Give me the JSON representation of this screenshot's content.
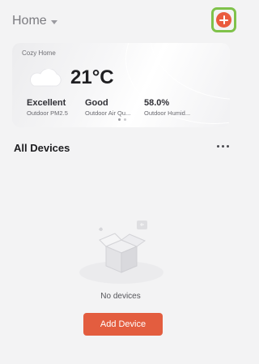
{
  "header": {
    "home_name": "Home",
    "add_button_color": "#ea5b3e",
    "highlight_color": "#7fc24a"
  },
  "weather_card": {
    "home_label": "Cozy Home",
    "weather_icon": "cloud-icon",
    "temperature": "21°C",
    "metrics": [
      {
        "value": "Excellent",
        "label": "Outdoor PM2.5"
      },
      {
        "value": "Good",
        "label": "Outdoor Air Qu..."
      },
      {
        "value": "58.0%",
        "label": "Outdoor Humid..."
      }
    ],
    "pager": {
      "pages": 2,
      "active": 1
    }
  },
  "devices": {
    "title": "All Devices",
    "more_icon": "more-dots-icon",
    "empty_illustration": "empty-box-icon",
    "empty_text": "No devices",
    "add_device_label": "Add Device",
    "button_color": "#e35d3f"
  }
}
